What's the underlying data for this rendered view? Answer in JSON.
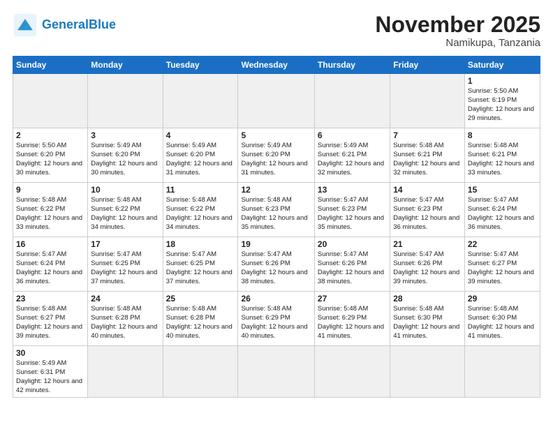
{
  "header": {
    "logo_general": "General",
    "logo_blue": "Blue",
    "month_title": "November 2025",
    "subtitle": "Namikupa, Tanzania"
  },
  "weekdays": [
    "Sunday",
    "Monday",
    "Tuesday",
    "Wednesday",
    "Thursday",
    "Friday",
    "Saturday"
  ],
  "weeks": [
    [
      {
        "day": "",
        "info": ""
      },
      {
        "day": "",
        "info": ""
      },
      {
        "day": "",
        "info": ""
      },
      {
        "day": "",
        "info": ""
      },
      {
        "day": "",
        "info": ""
      },
      {
        "day": "",
        "info": ""
      },
      {
        "day": "1",
        "info": "Sunrise: 5:50 AM\nSunset: 6:19 PM\nDaylight: 12 hours\nand 29 minutes."
      }
    ],
    [
      {
        "day": "2",
        "info": "Sunrise: 5:50 AM\nSunset: 6:20 PM\nDaylight: 12 hours\nand 30 minutes."
      },
      {
        "day": "3",
        "info": "Sunrise: 5:49 AM\nSunset: 6:20 PM\nDaylight: 12 hours\nand 30 minutes."
      },
      {
        "day": "4",
        "info": "Sunrise: 5:49 AM\nSunset: 6:20 PM\nDaylight: 12 hours\nand 31 minutes."
      },
      {
        "day": "5",
        "info": "Sunrise: 5:49 AM\nSunset: 6:20 PM\nDaylight: 12 hours\nand 31 minutes."
      },
      {
        "day": "6",
        "info": "Sunrise: 5:49 AM\nSunset: 6:21 PM\nDaylight: 12 hours\nand 32 minutes."
      },
      {
        "day": "7",
        "info": "Sunrise: 5:48 AM\nSunset: 6:21 PM\nDaylight: 12 hours\nand 32 minutes."
      },
      {
        "day": "8",
        "info": "Sunrise: 5:48 AM\nSunset: 6:21 PM\nDaylight: 12 hours\nand 33 minutes."
      }
    ],
    [
      {
        "day": "9",
        "info": "Sunrise: 5:48 AM\nSunset: 6:22 PM\nDaylight: 12 hours\nand 33 minutes."
      },
      {
        "day": "10",
        "info": "Sunrise: 5:48 AM\nSunset: 6:22 PM\nDaylight: 12 hours\nand 34 minutes."
      },
      {
        "day": "11",
        "info": "Sunrise: 5:48 AM\nSunset: 6:22 PM\nDaylight: 12 hours\nand 34 minutes."
      },
      {
        "day": "12",
        "info": "Sunrise: 5:48 AM\nSunset: 6:23 PM\nDaylight: 12 hours\nand 35 minutes."
      },
      {
        "day": "13",
        "info": "Sunrise: 5:47 AM\nSunset: 6:23 PM\nDaylight: 12 hours\nand 35 minutes."
      },
      {
        "day": "14",
        "info": "Sunrise: 5:47 AM\nSunset: 6:23 PM\nDaylight: 12 hours\nand 36 minutes."
      },
      {
        "day": "15",
        "info": "Sunrise: 5:47 AM\nSunset: 6:24 PM\nDaylight: 12 hours\nand 36 minutes."
      }
    ],
    [
      {
        "day": "16",
        "info": "Sunrise: 5:47 AM\nSunset: 6:24 PM\nDaylight: 12 hours\nand 36 minutes."
      },
      {
        "day": "17",
        "info": "Sunrise: 5:47 AM\nSunset: 6:25 PM\nDaylight: 12 hours\nand 37 minutes."
      },
      {
        "day": "18",
        "info": "Sunrise: 5:47 AM\nSunset: 6:25 PM\nDaylight: 12 hours\nand 37 minutes."
      },
      {
        "day": "19",
        "info": "Sunrise: 5:47 AM\nSunset: 6:26 PM\nDaylight: 12 hours\nand 38 minutes."
      },
      {
        "day": "20",
        "info": "Sunrise: 5:47 AM\nSunset: 6:26 PM\nDaylight: 12 hours\nand 38 minutes."
      },
      {
        "day": "21",
        "info": "Sunrise: 5:47 AM\nSunset: 6:26 PM\nDaylight: 12 hours\nand 39 minutes."
      },
      {
        "day": "22",
        "info": "Sunrise: 5:47 AM\nSunset: 6:27 PM\nDaylight: 12 hours\nand 39 minutes."
      }
    ],
    [
      {
        "day": "23",
        "info": "Sunrise: 5:48 AM\nSunset: 6:27 PM\nDaylight: 12 hours\nand 39 minutes."
      },
      {
        "day": "24",
        "info": "Sunrise: 5:48 AM\nSunset: 6:28 PM\nDaylight: 12 hours\nand 40 minutes."
      },
      {
        "day": "25",
        "info": "Sunrise: 5:48 AM\nSunset: 6:28 PM\nDaylight: 12 hours\nand 40 minutes."
      },
      {
        "day": "26",
        "info": "Sunrise: 5:48 AM\nSunset: 6:29 PM\nDaylight: 12 hours\nand 40 minutes."
      },
      {
        "day": "27",
        "info": "Sunrise: 5:48 AM\nSunset: 6:29 PM\nDaylight: 12 hours\nand 41 minutes."
      },
      {
        "day": "28",
        "info": "Sunrise: 5:48 AM\nSunset: 6:30 PM\nDaylight: 12 hours\nand 41 minutes."
      },
      {
        "day": "29",
        "info": "Sunrise: 5:48 AM\nSunset: 6:30 PM\nDaylight: 12 hours\nand 41 minutes."
      }
    ],
    [
      {
        "day": "30",
        "info": "Sunrise: 5:49 AM\nSunset: 6:31 PM\nDaylight: 12 hours\nand 42 minutes."
      },
      {
        "day": "",
        "info": ""
      },
      {
        "day": "",
        "info": ""
      },
      {
        "day": "",
        "info": ""
      },
      {
        "day": "",
        "info": ""
      },
      {
        "day": "",
        "info": ""
      },
      {
        "day": "",
        "info": ""
      }
    ]
  ]
}
